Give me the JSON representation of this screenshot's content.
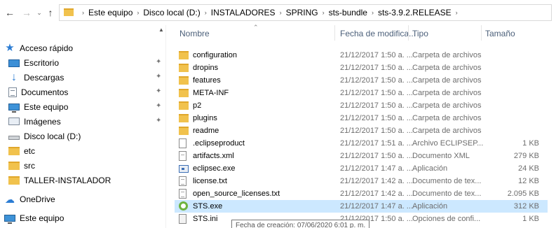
{
  "toolbar": {
    "back_icon": "arrow-left-icon",
    "forward_icon": "arrow-right-icon",
    "recent_icon": "chevron-down-icon",
    "up_icon": "arrow-up-icon",
    "separator": "›"
  },
  "breadcrumbs": [
    "Este equipo",
    "Disco local (D:)",
    "INSTALADORES",
    "SPRING",
    "sts-bundle",
    "sts-3.9.2.RELEASE"
  ],
  "sidebar": {
    "items": [
      {
        "label": "Acceso rápido",
        "icon": "star-icon",
        "pinned": false
      },
      {
        "label": "Escritorio",
        "icon": "desktop-icon",
        "pinned": true
      },
      {
        "label": "Descargas",
        "icon": "download-icon",
        "pinned": true
      },
      {
        "label": "Documentos",
        "icon": "documents-icon",
        "pinned": true
      },
      {
        "label": "Este equipo",
        "icon": "computer-icon",
        "pinned": true
      },
      {
        "label": "Imágenes",
        "icon": "images-icon",
        "pinned": true
      },
      {
        "label": "Disco local (D:)",
        "icon": "disk-icon",
        "pinned": false
      },
      {
        "label": "etc",
        "icon": "folder-icon",
        "pinned": false
      },
      {
        "label": "src",
        "icon": "folder-icon",
        "pinned": false
      },
      {
        "label": "TALLER-INSTALADOR",
        "icon": "folder-icon",
        "pinned": false
      },
      {
        "label": "OneDrive",
        "icon": "cloud-icon",
        "pinned": false
      },
      {
        "label": "Este equipo",
        "icon": "computer-icon",
        "pinned": false
      }
    ]
  },
  "columns": {
    "name": "Nombre",
    "date": "Fecha de modifica...",
    "type": "Tipo",
    "size": "Tamaño"
  },
  "files": [
    {
      "name": "configuration",
      "date": "21/12/2017 1:50 a. ...",
      "type": "Carpeta de archivos",
      "size": "",
      "icon": "folder-icon"
    },
    {
      "name": "dropins",
      "date": "21/12/2017 1:50 a. ...",
      "type": "Carpeta de archivos",
      "size": "",
      "icon": "folder-icon"
    },
    {
      "name": "features",
      "date": "21/12/2017 1:50 a. ...",
      "type": "Carpeta de archivos",
      "size": "",
      "icon": "folder-icon"
    },
    {
      "name": "META-INF",
      "date": "21/12/2017 1:50 a. ...",
      "type": "Carpeta de archivos",
      "size": "",
      "icon": "folder-icon"
    },
    {
      "name": "p2",
      "date": "21/12/2017 1:50 a. ...",
      "type": "Carpeta de archivos",
      "size": "",
      "icon": "folder-icon"
    },
    {
      "name": "plugins",
      "date": "21/12/2017 1:50 a. ...",
      "type": "Carpeta de archivos",
      "size": "",
      "icon": "folder-icon"
    },
    {
      "name": "readme",
      "date": "21/12/2017 1:50 a. ...",
      "type": "Carpeta de archivos",
      "size": "",
      "icon": "folder-icon"
    },
    {
      "name": ".eclipseproduct",
      "date": "21/12/2017 1:51 a. ...",
      "type": "Archivo ECLIPSEP...",
      "size": "1 KB",
      "icon": "file-icon"
    },
    {
      "name": "artifacts.xml",
      "date": "21/12/2017 1:50 a. ...",
      "type": "Documento XML",
      "size": "279 KB",
      "icon": "xml-file-icon"
    },
    {
      "name": "eclipsec.exe",
      "date": "21/12/2017 1:47 a. ...",
      "type": "Aplicación",
      "size": "24 KB",
      "icon": "application-icon"
    },
    {
      "name": "license.txt",
      "date": "21/12/2017 1:42 a. ...",
      "type": "Documento de tex...",
      "size": "12 KB",
      "icon": "text-file-icon"
    },
    {
      "name": "open_source_licenses.txt",
      "date": "21/12/2017 1:42 a. ...",
      "type": "Documento de tex...",
      "size": "2.095 KB",
      "icon": "text-file-icon"
    },
    {
      "name": "STS.exe",
      "date": "21/12/2017 1:47 a. ...",
      "type": "Aplicación",
      "size": "312 KB",
      "icon": "sts-app-icon",
      "selected": true
    },
    {
      "name": "STS.ini",
      "date": "21/12/2017 1:50 a. ...",
      "type": "Opciones de confi...",
      "size": "1 KB",
      "icon": "settings-file-icon"
    }
  ],
  "tooltip": "Fecha de creación: 07/06/2020 6:01 p. m."
}
